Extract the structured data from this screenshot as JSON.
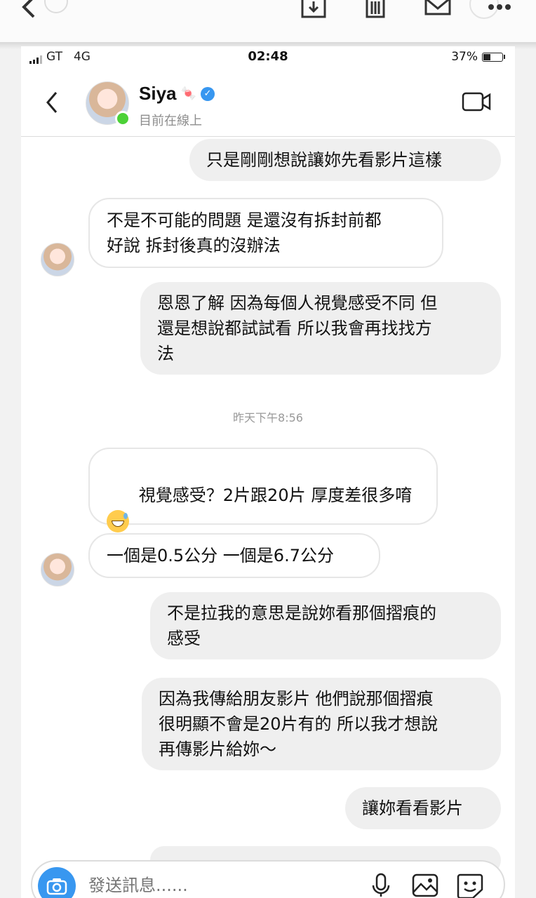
{
  "status_bar": {
    "carrier": "GT",
    "network": "4G",
    "time": "02:48",
    "battery": "37%"
  },
  "header": {
    "name": "Siya",
    "presence": "目前在線上"
  },
  "messages": [
    {
      "side": "out",
      "text": "只是剛剛想說讓妳先看影片這樣"
    },
    {
      "side": "in",
      "text": "不是不可能的問題 是還沒有拆封前都\n好說 拆封後真的沒辦法"
    },
    {
      "side": "out",
      "text": "恩恩了解 因為每個人視覺感受不同 但\n還是想說都試試看 所以我會再找找方\n法"
    },
    {
      "side": "in",
      "text": "視覺感受？2片跟20片 厚度差很多唷"
    },
    {
      "side": "in",
      "text": "一個是0.5公分 一個是6.7公分"
    },
    {
      "side": "out",
      "text": "不是拉我的意思是說妳看那個摺痕的\n感受"
    },
    {
      "side": "out",
      "text": "因為我傳給朋友影片 他們說那個摺痕\n很明顯不會是20片有的 所以我才想說\n再傳影片給妳～"
    },
    {
      "side": "out",
      "text": "讓妳看看影片"
    }
  ],
  "timestamp": "昨天下午8:56",
  "composer": {
    "placeholder": "發送訊息......"
  },
  "colors": {
    "accent": "#3897f0",
    "online": "#4cd137",
    "outgoing_bubble": "#efefef"
  },
  "icons": [
    "back-chevron-icon",
    "download-icon",
    "trash-icon",
    "mail-icon",
    "more-icon",
    "video-call-icon",
    "verified-badge-icon",
    "camera-icon",
    "microphone-icon",
    "gallery-icon",
    "sticker-icon"
  ]
}
